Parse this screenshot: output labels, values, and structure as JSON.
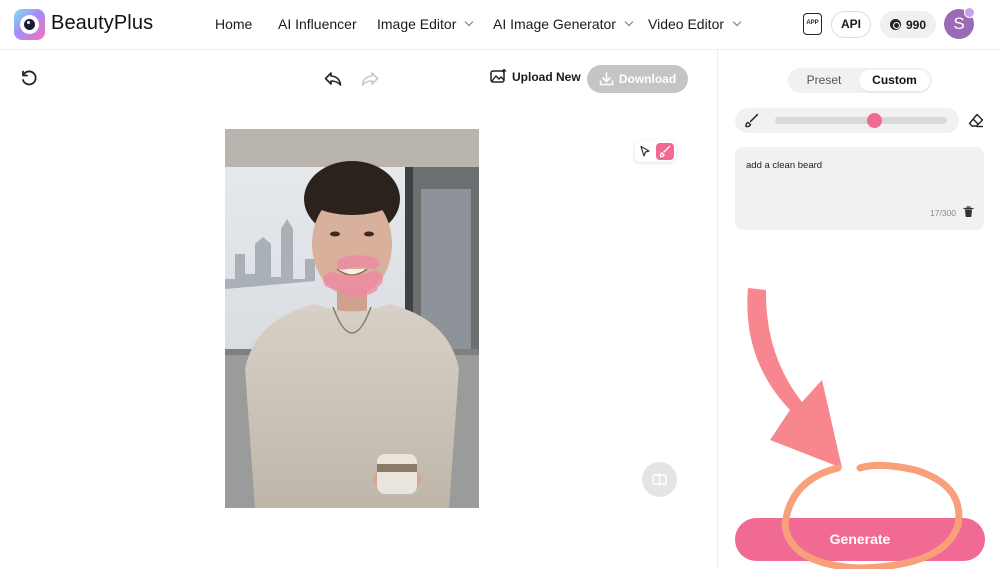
{
  "header": {
    "brand": "BeautyPlus",
    "nav": [
      "Home",
      "AI Influencer",
      "Image Editor",
      "AI Image Generator",
      "Video Editor"
    ],
    "app_label": "APP",
    "api_label": "API",
    "credits": "990",
    "avatar_initial": "S"
  },
  "toolbar": {
    "upload_label": "Upload New",
    "download_label": "Download"
  },
  "panel": {
    "tabs": [
      "Preset",
      "Custom"
    ],
    "active_tab": "Custom",
    "brush_size_fraction": 0.58,
    "prompt_text": "add a clean beard",
    "prompt_count": "17/300",
    "generate_label": "Generate"
  },
  "colors": {
    "accent": "#f06a94",
    "disabled": "#c5c5c5",
    "annotation": "#f5868f"
  }
}
